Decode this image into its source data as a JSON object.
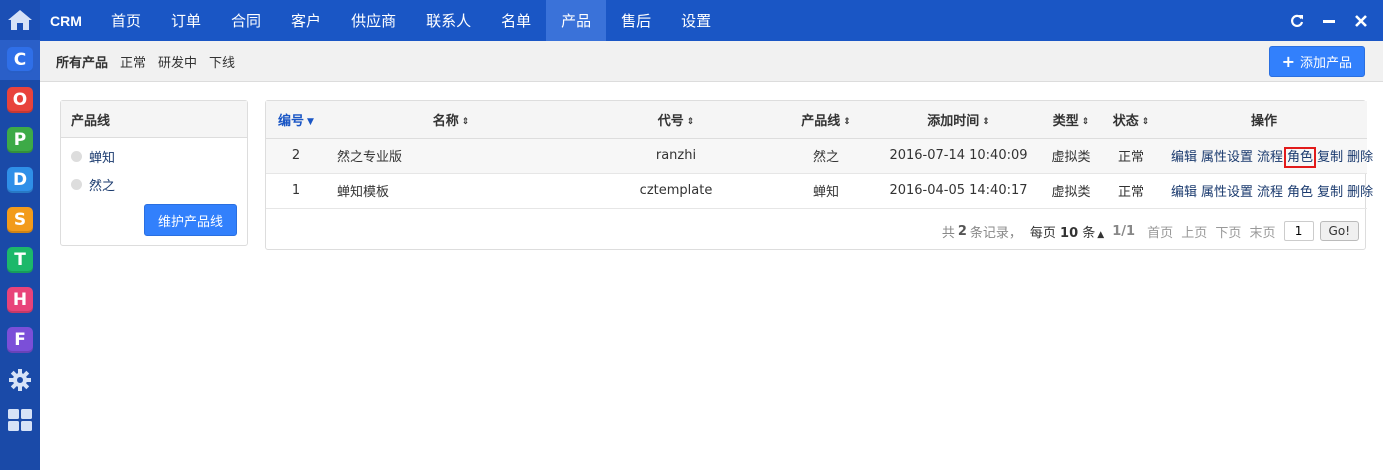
{
  "navbar": {
    "brand": "CRM",
    "items": [
      {
        "label": "首页"
      },
      {
        "label": "订单"
      },
      {
        "label": "合同"
      },
      {
        "label": "客户"
      },
      {
        "label": "供应商"
      },
      {
        "label": "联系人"
      },
      {
        "label": "名单"
      },
      {
        "label": "产品",
        "active": true
      },
      {
        "label": "售后"
      },
      {
        "label": "设置"
      }
    ],
    "window_controls": [
      "refresh-icon",
      "minimize-icon",
      "close-icon"
    ]
  },
  "dock": {
    "home_icon": "home-icon",
    "apps": [
      {
        "letter": "C",
        "color": "#2f6fe8",
        "icon": "app-c-icon"
      },
      {
        "letter": "O",
        "color": "#e8433c",
        "icon": "app-o-icon"
      },
      {
        "letter": "P",
        "color": "#3daa47",
        "icon": "app-p-icon"
      },
      {
        "letter": "D",
        "color": "#2f8fe8",
        "icon": "app-d-icon"
      },
      {
        "letter": "S",
        "color": "#f29b1b",
        "icon": "app-s-icon"
      },
      {
        "letter": "T",
        "color": "#1cb86a",
        "icon": "app-t-icon"
      },
      {
        "letter": "H",
        "color": "#e8437a",
        "icon": "app-h-icon"
      },
      {
        "letter": "F",
        "color": "#7b4fd8",
        "icon": "app-f-icon"
      }
    ],
    "settings_icon": "gear-icon",
    "grid_icon": "grid-icon"
  },
  "subnav": {
    "items": [
      {
        "label": "所有产品",
        "active": true
      },
      {
        "label": "正常"
      },
      {
        "label": "研发中"
      },
      {
        "label": "下线"
      }
    ],
    "add_button": "添加产品"
  },
  "product_lines": {
    "title": "产品线",
    "items": [
      "蝉知",
      "然之"
    ],
    "maintain_button": "维护产品线"
  },
  "table": {
    "headers": {
      "id": "编号",
      "name": "名称",
      "code": "代号",
      "line": "产品线",
      "added": "添加时间",
      "type": "类型",
      "status": "状态",
      "actions": "操作"
    },
    "rows": [
      {
        "id": "2",
        "name": "然之专业版",
        "code": "ranzhi",
        "line": "然之",
        "added": "2016-07-14 10:40:09",
        "type": "虚拟类",
        "status": "正常"
      },
      {
        "id": "1",
        "name": "蝉知模板",
        "code": "cztemplate",
        "line": "蝉知",
        "added": "2016-04-05 14:40:17",
        "type": "虚拟类",
        "status": "正常"
      }
    ],
    "row_actions": [
      "编辑",
      "属性设置",
      "流程",
      "角色",
      "复制",
      "删除"
    ],
    "highlighted_action": "角色"
  },
  "pager": {
    "total_prefix": "共",
    "total": "2",
    "total_suffix": "条记录，",
    "per_page_prefix": "每页",
    "per_page": "10",
    "per_page_suffix": "条",
    "page_fraction": "1/1",
    "first": "首页",
    "prev": "上页",
    "next": "下页",
    "last": "末页",
    "page_input": "1",
    "go": "Go!"
  },
  "colors": {
    "navbar": "#1a56c5",
    "dock": "#1a4aa8",
    "primary_button": "#3280fc",
    "highlight_box": "#e21b1b"
  }
}
